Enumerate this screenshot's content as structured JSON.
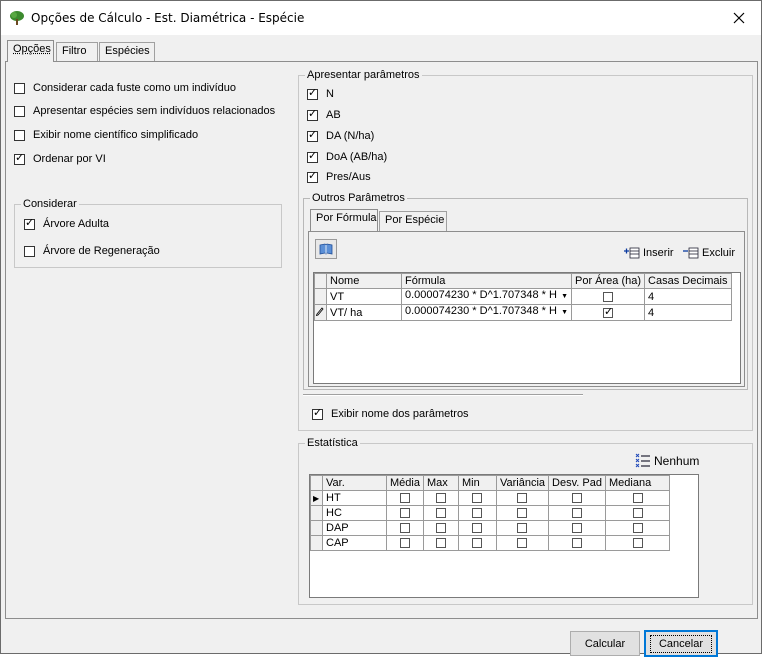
{
  "window": {
    "title": "Opções de Cálculo - Est. Diamétrica - Espécie"
  },
  "tabs": [
    {
      "label": "Opções",
      "active": true
    },
    {
      "label": "Filtro"
    },
    {
      "label": "Espécies"
    }
  ],
  "options": {
    "consider_each_stem": {
      "label": "Considerar cada fuste como um indivíduo",
      "checked": false
    },
    "show_species_no_individuals": {
      "label": "Apresentar espécies sem indivíduos relacionados",
      "checked": false
    },
    "show_scientific_name": {
      "label": "Exibir nome científico simplificado",
      "checked": false
    },
    "order_by_vi": {
      "label": "Ordenar por VI",
      "checked": true
    }
  },
  "considerar": {
    "title": "Considerar",
    "adult_tree": {
      "label": "Árvore Adulta",
      "checked": true
    },
    "regen_tree": {
      "label": "Árvore de Regeneração",
      "checked": false
    }
  },
  "params": {
    "title": "Apresentar parâmetros",
    "items": [
      {
        "label": "N",
        "checked": true
      },
      {
        "label": "AB",
        "checked": true
      },
      {
        "label": "DA (N/ha)",
        "checked": true
      },
      {
        "label": "DoA (AB/ha)",
        "checked": true
      },
      {
        "label": "Pres/Aus",
        "checked": true
      }
    ],
    "outros": {
      "title": "Outros Parâmetros",
      "tabs": [
        {
          "label": "Por Fórmula",
          "active": true
        },
        {
          "label": "Por Espécie"
        }
      ],
      "insert_label": "Inserir",
      "delete_label": "Excluir",
      "columns": {
        "nome": "Nome",
        "formula": "Fórmula",
        "por_area": "Por Área (ha)",
        "casas": "Casas Decimais"
      },
      "rows": [
        {
          "nome": "VT",
          "formula": "0.000074230 * D^1.707348 * H",
          "por_area": false,
          "casas": "4"
        },
        {
          "nome": "VT/ ha",
          "formula": "0.000074230 * D^1.707348 * H",
          "por_area": true,
          "casas": "4"
        }
      ]
    },
    "show_param_names": {
      "label": "Exibir nome dos parâmetros",
      "checked": true
    }
  },
  "estatistica": {
    "title": "Estatística",
    "none_label": "Nenhum",
    "columns": [
      "Var.",
      "Média",
      "Max",
      "Min",
      "Variância",
      "Desv. Pad",
      "Mediana"
    ],
    "rows": [
      "HT",
      "HC",
      "DAP",
      "CAP"
    ]
  },
  "buttons": {
    "calcular": "Calcular",
    "cancelar": "Cancelar"
  }
}
